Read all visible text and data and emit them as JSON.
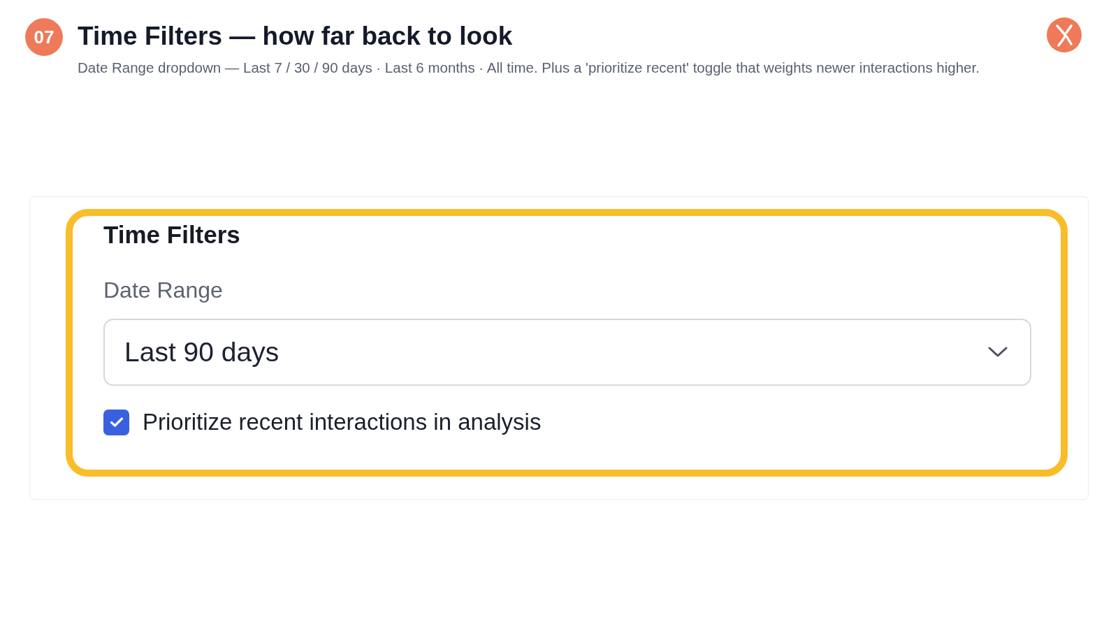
{
  "header": {
    "step": "07",
    "title": "Time Filters — how far back to look",
    "subtitle": "Date Range dropdown — Last 7 / 30 / 90 days · Last 6 months · All time. Plus a 'prioritize recent' toggle that weights newer interactions higher."
  },
  "panel": {
    "highlighted": true,
    "title": "Time Filters",
    "date_range": {
      "label": "Date Range",
      "value": "Last 90 days"
    },
    "options": [
      {
        "kind": "checkbox",
        "label": "Prioritize recent interactions in analysis",
        "checked": true
      }
    ]
  }
}
